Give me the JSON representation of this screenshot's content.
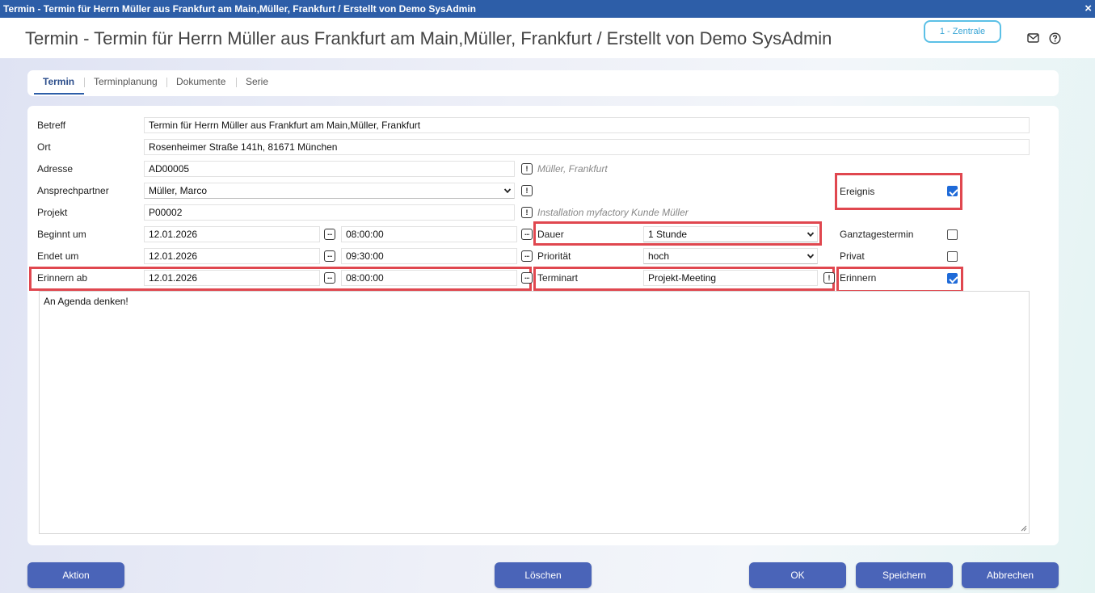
{
  "window": {
    "title": "Termin - Termin für Herrn Müller aus Frankfurt am Main,Müller, Frankfurt / Erstellt von Demo SysAdmin",
    "close_glyph": "×"
  },
  "header": {
    "title": "Termin - Termin für Herrn Müller aus Frankfurt am Main,Müller, Frankfurt / Erstellt von Demo SysAdmin",
    "org_badge": "1 - Zentrale",
    "icons": [
      "mail-icon",
      "help-icon"
    ]
  },
  "tabs": [
    {
      "label": "Termin",
      "active": true
    },
    {
      "label": "Terminplanung",
      "active": false
    },
    {
      "label": "Dokumente",
      "active": false
    },
    {
      "label": "Serie",
      "active": false
    }
  ],
  "form": {
    "betreff": {
      "label": "Betreff",
      "value": "Termin für Herrn Müller aus Frankfurt am Main,Müller, Frankfurt"
    },
    "ort": {
      "label": "Ort",
      "value": "Rosenheimer Straße 141h, 81671 München"
    },
    "adresse": {
      "label": "Adresse",
      "value": "AD00005",
      "hint": "Müller, Frankfurt"
    },
    "ansprechpartner": {
      "label": "Ansprechpartner",
      "value": "Müller, Marco"
    },
    "projekt": {
      "label": "Projekt",
      "value": "P00002",
      "hint": "Installation myfactory Kunde Müller"
    },
    "beginnt": {
      "label": "Beginnt um",
      "date": "12.01.2026",
      "time": "08:00:00"
    },
    "endet": {
      "label": "Endet um",
      "date": "12.01.2026",
      "time": "09:30:00"
    },
    "erinnern_ab": {
      "label": "Erinnern ab",
      "date": "12.01.2026",
      "time": "08:00:00"
    },
    "dauer": {
      "label": "Dauer",
      "value": "1 Stunde"
    },
    "prioritaet": {
      "label": "Priorität",
      "value": "hoch"
    },
    "terminart": {
      "label": "Terminart",
      "value": "Projekt-Meeting"
    },
    "ereignis": {
      "label": "Ereignis",
      "checked": true
    },
    "ganztagestermin": {
      "label": "Ganztagestermin",
      "checked": false
    },
    "privat": {
      "label": "Privat",
      "checked": false
    },
    "erinnern": {
      "label": "Erinnern",
      "checked": true
    },
    "notes": "An Agenda denken!"
  },
  "buttons": {
    "aktion": "Aktion",
    "loeschen": "Löschen",
    "ok": "OK",
    "speichern": "Speichern",
    "abbrechen": "Abbrechen"
  },
  "colors": {
    "titlebar": "#2d5ea8",
    "button": "#4a64b8",
    "highlight": "#e0474f",
    "checkbox": "#1e6ad8",
    "badge": "#5bc0e6"
  }
}
